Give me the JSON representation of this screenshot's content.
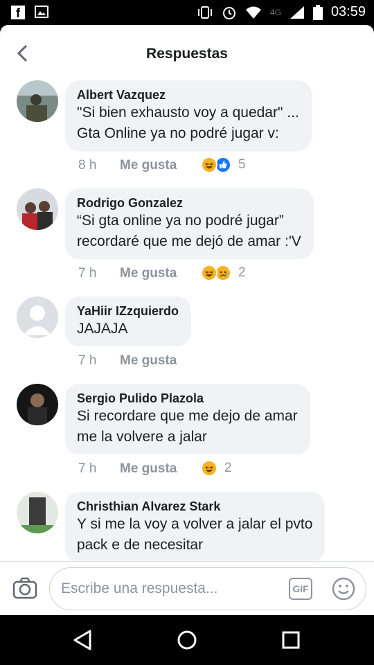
{
  "status_bar": {
    "time": "03:59",
    "network": "4G"
  },
  "header": {
    "title": "Respuestas"
  },
  "comments": [
    {
      "author": "Albert Vazquez",
      "lines": [
        "\"Si bien exhausto voy a quedar\" ...",
        "Gta Online ya no podré jugar v:"
      ],
      "time": "8 h",
      "like_label": "Me gusta",
      "reactions": [
        "haha",
        "like"
      ],
      "reaction_count": "5"
    },
    {
      "author": "Rodrigo Gonzalez",
      "lines": [
        "“Si gta online ya no podré jugar”",
        "recordaré que me dejó de amar :'V"
      ],
      "time": "7 h",
      "like_label": "Me gusta",
      "reactions": [
        "haha",
        "sad"
      ],
      "reaction_count": "2"
    },
    {
      "author": "YaHiir IZzquierdo",
      "lines": [
        "JAJAJA"
      ],
      "time": "7 h",
      "like_label": "Me gusta",
      "reactions": [],
      "reaction_count": ""
    },
    {
      "author": "Sergio Pulido Plazola",
      "lines": [
        "Si recordare que me dejo de amar",
        "me la volvere a jalar"
      ],
      "time": "7 h",
      "like_label": "Me gusta",
      "reactions": [
        "haha"
      ],
      "reaction_count": "2"
    },
    {
      "author": "Christhian Alvarez Stark",
      "lines": [
        "Y si me la voy a volver a jalar el pvto",
        "pack e de necesitar"
      ],
      "time": "",
      "like_label": "",
      "reactions": [],
      "reaction_count": ""
    }
  ],
  "composer": {
    "placeholder": "Escribe una respuesta...",
    "gif_label": "GIF"
  },
  "colors": {
    "bubble": "#f0f2f5",
    "meta_text": "#8d949e",
    "like_blue": "#1877f2",
    "haha_yellow": "#f7b125"
  },
  "icons": [
    "facebook-icon",
    "gallery-icon",
    "vibrate-icon",
    "alarm-icon",
    "wifi-icon",
    "signal-icon",
    "battery-icon",
    "back-arrow-icon",
    "camera-icon",
    "gif-icon",
    "smiley-icon",
    "nav-back-icon",
    "nav-home-icon",
    "nav-recents-icon"
  ]
}
